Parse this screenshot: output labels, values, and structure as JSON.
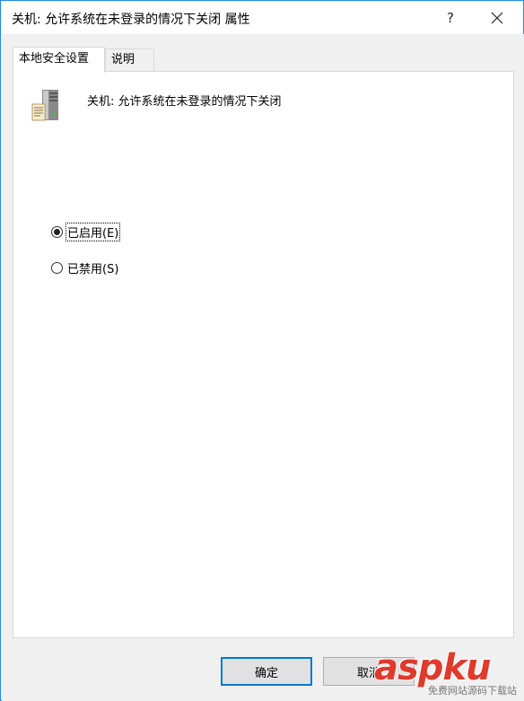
{
  "window": {
    "title": "关机: 允许系统在未登录的情况下关闭 属性",
    "help_label": "?",
    "close_icon": "close-icon"
  },
  "tabs": [
    {
      "label": "本地安全设置",
      "active": true
    },
    {
      "label": "说明",
      "active": false
    }
  ],
  "policy": {
    "icon": "server-policy-icon",
    "title": "关机: 允许系统在未登录的情况下关闭"
  },
  "options": [
    {
      "label": "已启用(E)",
      "checked": true
    },
    {
      "label": "已禁用(S)",
      "checked": false
    }
  ],
  "buttons": {
    "ok_label": "确定",
    "cancel_label": "取消"
  },
  "watermark": {
    "logo": "aspku",
    "sub": "免费网站源码下载站"
  },
  "colors": {
    "border_accent": "#1e8be8",
    "default_button_border": "#0078d7",
    "dialog_bg": "#f0f0f0",
    "watermark_red": "#e03a2c"
  }
}
